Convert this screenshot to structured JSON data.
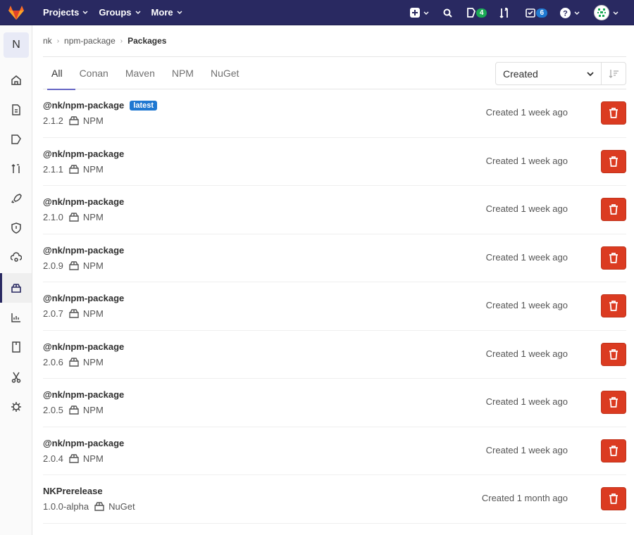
{
  "topbar": {
    "nav": [
      {
        "label": "Projects"
      },
      {
        "label": "Groups"
      },
      {
        "label": "More"
      }
    ],
    "issues_count": "4",
    "todos_count": "6"
  },
  "sidebar": {
    "project_initial": "N",
    "items": [
      {
        "name": "project-overview",
        "icon": "home-icon"
      },
      {
        "name": "repository",
        "icon": "document-icon"
      },
      {
        "name": "issues",
        "icon": "issues-icon"
      },
      {
        "name": "merge-requests",
        "icon": "merge-request-icon"
      },
      {
        "name": "ci-cd",
        "icon": "rocket-icon"
      },
      {
        "name": "security",
        "icon": "shield-icon"
      },
      {
        "name": "operations",
        "icon": "cloud-gear-icon"
      },
      {
        "name": "packages",
        "icon": "package-icon",
        "active": true
      },
      {
        "name": "analytics",
        "icon": "chart-icon"
      },
      {
        "name": "wiki",
        "icon": "book-icon"
      },
      {
        "name": "snippets",
        "icon": "scissors-icon"
      },
      {
        "name": "settings",
        "icon": "gear-icon"
      }
    ]
  },
  "breadcrumb": {
    "items": [
      "nk",
      "npm-package"
    ],
    "current": "Packages"
  },
  "tabs": [
    {
      "label": "All",
      "active": true
    },
    {
      "label": "Conan"
    },
    {
      "label": "Maven"
    },
    {
      "label": "NPM"
    },
    {
      "label": "NuGet"
    }
  ],
  "sort": {
    "selected": "Created"
  },
  "colors": {
    "topbar": "#292961",
    "delete": "#db3b21",
    "badge_blue": "#1f78d1",
    "badge_green": "#1aaa55"
  },
  "packages": [
    {
      "name": "@nk/npm-package",
      "latest": "latest",
      "version": "2.1.2",
      "type": "NPM",
      "created": "Created 1 week ago"
    },
    {
      "name": "@nk/npm-package",
      "version": "2.1.1",
      "type": "NPM",
      "created": "Created 1 week ago"
    },
    {
      "name": "@nk/npm-package",
      "version": "2.1.0",
      "type": "NPM",
      "created": "Created 1 week ago"
    },
    {
      "name": "@nk/npm-package",
      "version": "2.0.9",
      "type": "NPM",
      "created": "Created 1 week ago"
    },
    {
      "name": "@nk/npm-package",
      "version": "2.0.7",
      "type": "NPM",
      "created": "Created 1 week ago"
    },
    {
      "name": "@nk/npm-package",
      "version": "2.0.6",
      "type": "NPM",
      "created": "Created 1 week ago"
    },
    {
      "name": "@nk/npm-package",
      "version": "2.0.5",
      "type": "NPM",
      "created": "Created 1 week ago"
    },
    {
      "name": "@nk/npm-package",
      "version": "2.0.4",
      "type": "NPM",
      "created": "Created 1 week ago"
    },
    {
      "name": "NKPrerelease",
      "version": "1.0.0-alpha",
      "type": "NuGet",
      "created": "Created 1 month ago"
    }
  ]
}
